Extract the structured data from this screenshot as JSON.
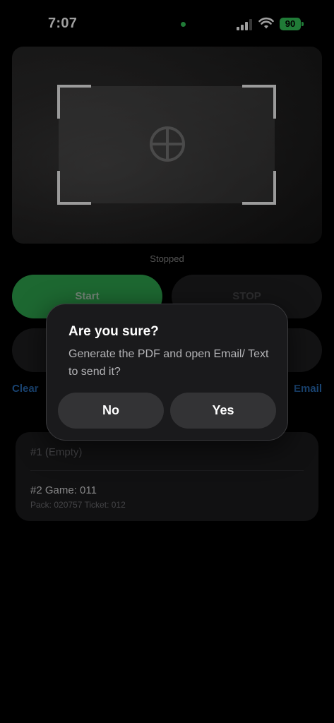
{
  "status_bar": {
    "time": "7:07",
    "battery": "90"
  },
  "scanner": {
    "status": "Stopped"
  },
  "controls": {
    "start_label": "Start",
    "stop_label": "STOP",
    "clear_label": "Clear",
    "email_label": "Email"
  },
  "entries": [
    {
      "title": "#1  (Empty)"
    },
    {
      "title": "#2  Game: 011",
      "detail": "Pack: 020757  Ticket: 012"
    }
  ],
  "dialog": {
    "title": "Are you sure?",
    "message": "Generate the PDF and open Email/ Text to send it?",
    "no_label": "No",
    "yes_label": "Yes"
  },
  "colors": {
    "start_green": "#2fa84f",
    "link_blue": "#2a6fb8",
    "battery_green": "#34c759"
  }
}
